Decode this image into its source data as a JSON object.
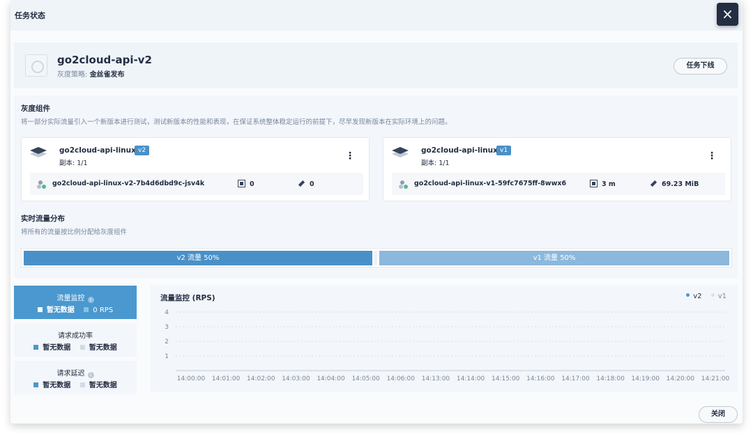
{
  "dialog": {
    "title": "任务状态",
    "close_icon": "×",
    "close_button": "关闭"
  },
  "app": {
    "name": "go2cloud-api-v2",
    "strategy_label": "灰度策略:",
    "strategy_value": "金丝雀发布",
    "offline_button": "任务下线"
  },
  "gray_section": {
    "title": "灰度组件",
    "description": "将一部分实际流量引入一个新版本进行测试，测试新版本的性能和表现，在保证系统整体稳定运行的前提下，尽早发现新版本在实际环境上的问题。"
  },
  "components": [
    {
      "name": "go2cloud-api-linux",
      "version": "v2",
      "replicas": "副本: 1/1",
      "pod": "go2cloud-api-linux-v2-7b4d6dbd9c-jsv4k",
      "cpu": "0",
      "memory": "0"
    },
    {
      "name": "go2cloud-api-linux",
      "version": "v1",
      "replicas": "副本: 1/1",
      "pod": "go2cloud-api-linux-v1-59fc7675ff-8wwx6",
      "cpu": "3 m",
      "memory": "69.23 MiB"
    }
  ],
  "traffic_section": {
    "title": "实时流量分布",
    "description": "将所有的流量按比例分配给灰度组件",
    "v2_label": "v2 流量 50%",
    "v1_label": "v1 流量 50%",
    "v2_percent": 50,
    "v1_percent": 50
  },
  "monitor_tabs": [
    {
      "title": "流量监控",
      "left": "暂无数据",
      "right": "0 RPS",
      "active": true,
      "info": true
    },
    {
      "title": "请求成功率",
      "left": "暂无数据",
      "right": "暂无数据",
      "active": false,
      "info": false
    },
    {
      "title": "请求延迟",
      "left": "暂无数据",
      "right": "暂无数据",
      "active": false,
      "info": true
    }
  ],
  "chart_data": {
    "type": "line",
    "title": "流量监控 (RPS)",
    "series": [
      {
        "name": "v2",
        "values": []
      },
      {
        "name": "v1",
        "values": []
      }
    ],
    "series_colors": [
      "#4a98cf",
      "#d8e2ec"
    ],
    "x_tick_labels": [
      "14:00:00",
      "14:01:00",
      "14:02:00",
      "14:03:00",
      "14:04:00",
      "14:05:00",
      "14:06:00",
      "14:13:00",
      "14:14:00",
      "14:15:00",
      "14:16:00",
      "14:17:00",
      "14:18:00",
      "14:19:00",
      "14:20:00",
      "14:21:00"
    ],
    "y_ticks": [
      1,
      2,
      3,
      4
    ],
    "grid": true,
    "legend_position": "top-right"
  },
  "colors": {
    "primary": "#4a98cf",
    "v2_bar": "#4a90c8",
    "v1_bar": "#8cb8dc",
    "text_dark": "#242e42",
    "text_muted": "#79879c"
  }
}
